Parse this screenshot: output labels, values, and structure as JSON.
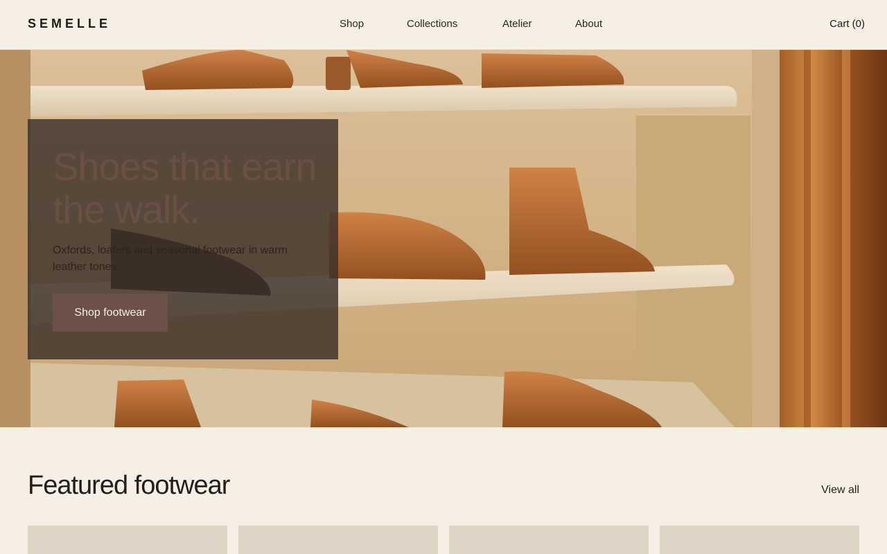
{
  "header": {
    "logo": "SEMELLE",
    "nav": [
      "Shop",
      "Collections",
      "Atelier",
      "About"
    ],
    "cart": "Cart (0)"
  },
  "hero": {
    "title": "Shoes that earn the walk.",
    "subtitle": "Oxfords, loafers and seasonal footwear in warm leather tones.",
    "cta": "Shop footwear"
  },
  "featured": {
    "title": "Featured footwear",
    "view_all": "View all",
    "cards": [
      "",
      "",
      "",
      ""
    ]
  },
  "colors": {
    "background": "#f5efe6",
    "accent": "#6b5148",
    "leather": "#b5692e"
  }
}
